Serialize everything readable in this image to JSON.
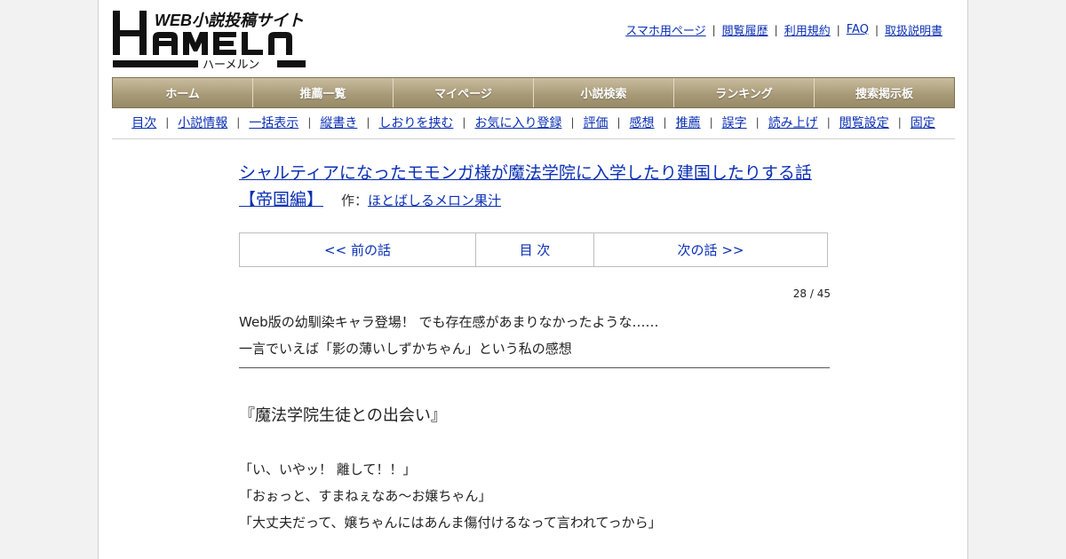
{
  "logo": {
    "tagline": "WEB小説投稿サイト",
    "name": "HAMELN",
    "kana": "ハーメルン"
  },
  "toplinks": [
    "スマホ用ページ",
    "閲覧履歴",
    "利用規約",
    "FAQ",
    "取扱説明書"
  ],
  "nav": [
    "ホーム",
    "推薦一覧",
    "マイページ",
    "小説検索",
    "ランキング",
    "捜索掲示板"
  ],
  "subnav": [
    "目次",
    "小説情報",
    "一括表示",
    "縦書き",
    "しおりを挟む",
    "お気に入り登録",
    "評価",
    "感想",
    "推薦",
    "誤字",
    "読み上げ",
    "閲覧設定",
    "固定"
  ],
  "novel": {
    "title": "シャルティアになったモモンガ様が魔法学院に入学したり建国したりする話【帝国編】",
    "author_prefix": "作：",
    "author": "ほとばしるメロン果汁"
  },
  "pager": {
    "prev": "<< 前の話",
    "toc": "目 次",
    "next": "次の話 >>"
  },
  "episode_count": "28 / 45",
  "foreword": [
    "Web版の幼馴染キャラ登場！ でも存在感があまりなかったような……",
    "一言でいえば「影の薄いしずかちゃん」という私の感想"
  ],
  "chapter_title": "『魔法学院生徒との出会い』",
  "body_lines": [
    "「い、いやッ！ 離して！！」",
    "「おぉっと、すまねぇなあ～お嬢ちゃん」",
    "「大丈夫だって、嬢ちゃんにはあんま傷付けるなって言われてっから」"
  ],
  "colors": {
    "link": "#0a2fb4",
    "nav_bg": "#a99b78"
  }
}
